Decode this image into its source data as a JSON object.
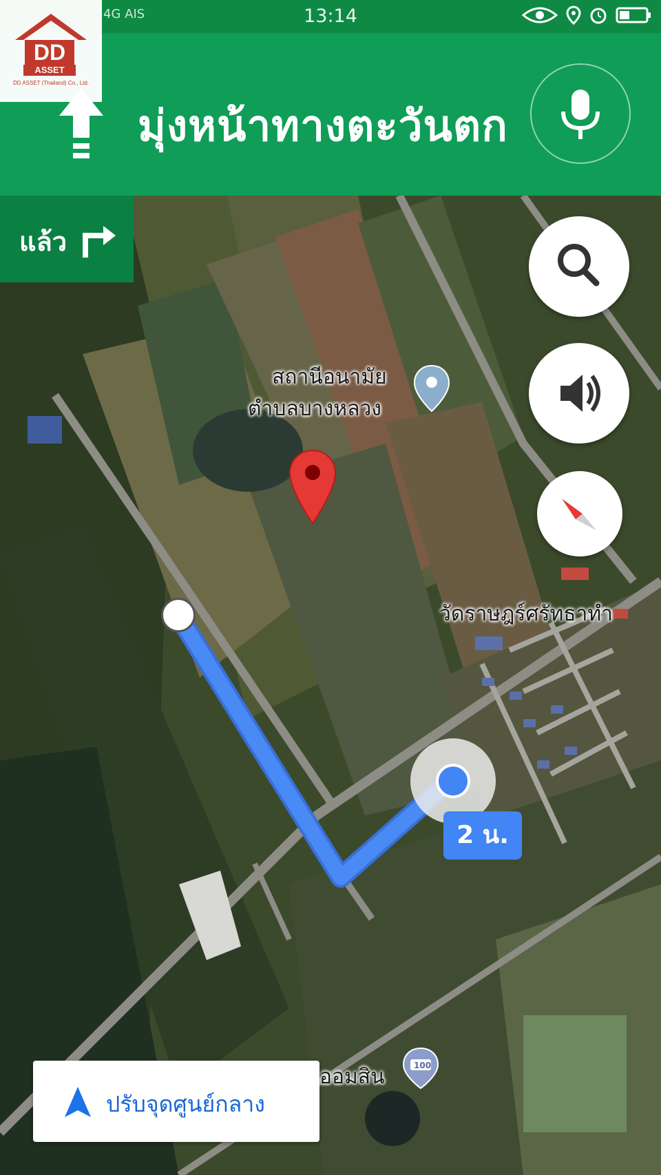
{
  "status_bar": {
    "time": "13:14",
    "network": "4G",
    "carrier": "AIS"
  },
  "logo": {
    "brand": "DD",
    "sub": "ASSET",
    "company": "DD ASSET (Thailand) Co., Ltd."
  },
  "navigation": {
    "instruction": "มุ่งหน้าทางตะวันตก",
    "then_label": "แล้ว"
  },
  "map": {
    "place_1_line1": "สถานีอนามัย",
    "place_1_line2": "ตำบลบางหลวง",
    "place_2": "วัดราษฎร์ศรัทธาทำ",
    "place_3": "ออมสิน",
    "poi_badge": "100",
    "eta": "2 น."
  },
  "recenter": {
    "label": "ปรับจุดศูนย์กลาง"
  },
  "colors": {
    "header": "#0f9d58",
    "then_box": "#0b8043",
    "route": "#4285f4",
    "pin": "#db4437"
  },
  "icons": [
    "up-arrow-icon",
    "mic-icon",
    "turn-right-icon",
    "search-icon",
    "volume-icon",
    "compass-icon",
    "pin-icon",
    "poi-marker-icon",
    "navigation-arrow-icon"
  ]
}
